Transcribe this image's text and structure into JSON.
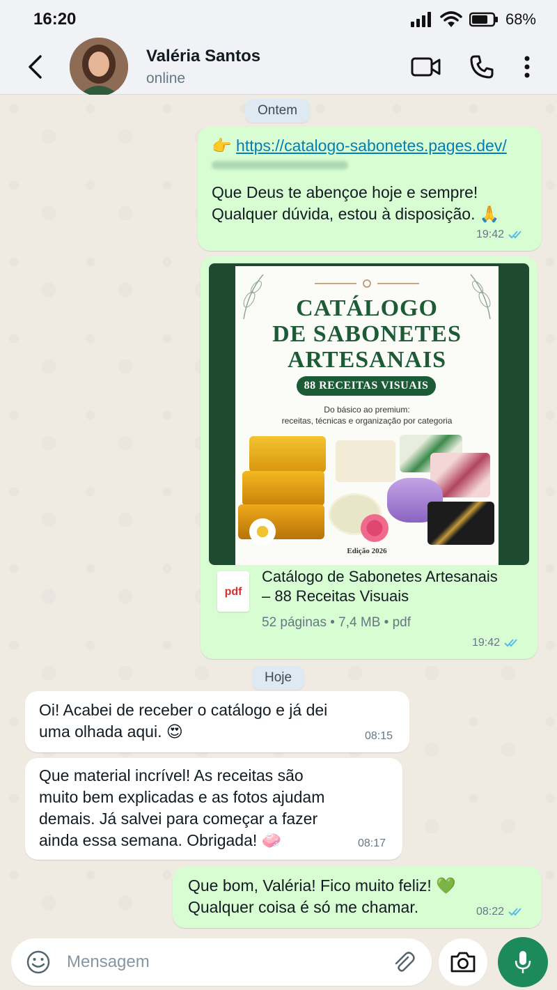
{
  "status_bar": {
    "time": "16:20",
    "battery": "68%"
  },
  "header": {
    "contact_name": "Valéria Santos",
    "contact_status": "online"
  },
  "dates": {
    "yesterday": "Ontem",
    "today": "Hoje"
  },
  "messages": [
    {
      "direction": "out",
      "emoji": "👉",
      "link": "https://catalogo-sabonetes.pages.dev/",
      "text_line1": "Que Deus te abençoe hoje e sempre!",
      "text_line2": "Qualquer dúvida, estou à disposição. 🙏",
      "time": "19:42"
    },
    {
      "direction": "out",
      "cover": {
        "title_line1": "CATÁLOGO",
        "title_line2": "DE SABONETES",
        "title_line3": "ARTESANAIS",
        "badge": "88 RECEITAS VISUAIS",
        "subtitle_line1": "Do básico ao premium:",
        "subtitle_line2": "receitas, técnicas e organização por categoria",
        "edition": "Edição 2026"
      },
      "file_icon": "pdf",
      "file_name_line1": "Catálogo de Sabonetes Artesanais",
      "file_name_line2": "– 88 Receitas Visuais",
      "file_info": "52 páginas • 7,4 MB • pdf",
      "time": "19:42"
    },
    {
      "direction": "in",
      "text_line1": "Oi! Acabei de receber o catálogo e já dei",
      "text_line2": "uma olhada aqui. 😍",
      "time": "08:15"
    },
    {
      "direction": "in",
      "text_line1": "Que material incrível! As receitas são",
      "text_line2": "muito bem explicadas e as fotos ajudam",
      "text_line3": "demais. Já salvei para começar a fazer",
      "text_line4": "ainda essa semana. Obrigada! 🧼",
      "time": "08:17"
    },
    {
      "direction": "out",
      "text_line1": "Que bom, Valéria! Fico muito feliz! 💚",
      "text_line2": "Qualquer coisa é só me chamar.",
      "time": "08:22"
    }
  ],
  "input": {
    "placeholder": "Mensagem"
  },
  "colors": {
    "outgoing": "#d9fdd3",
    "incoming": "#ffffff",
    "accent": "#1d8a5b",
    "read_ticks": "#53bdeb"
  },
  "icons": [
    "back-arrow-icon",
    "video-call-icon",
    "phone-icon",
    "more-icon",
    "emoji-icon",
    "attach-icon",
    "camera-icon",
    "mic-icon",
    "read-ticks-icon"
  ]
}
